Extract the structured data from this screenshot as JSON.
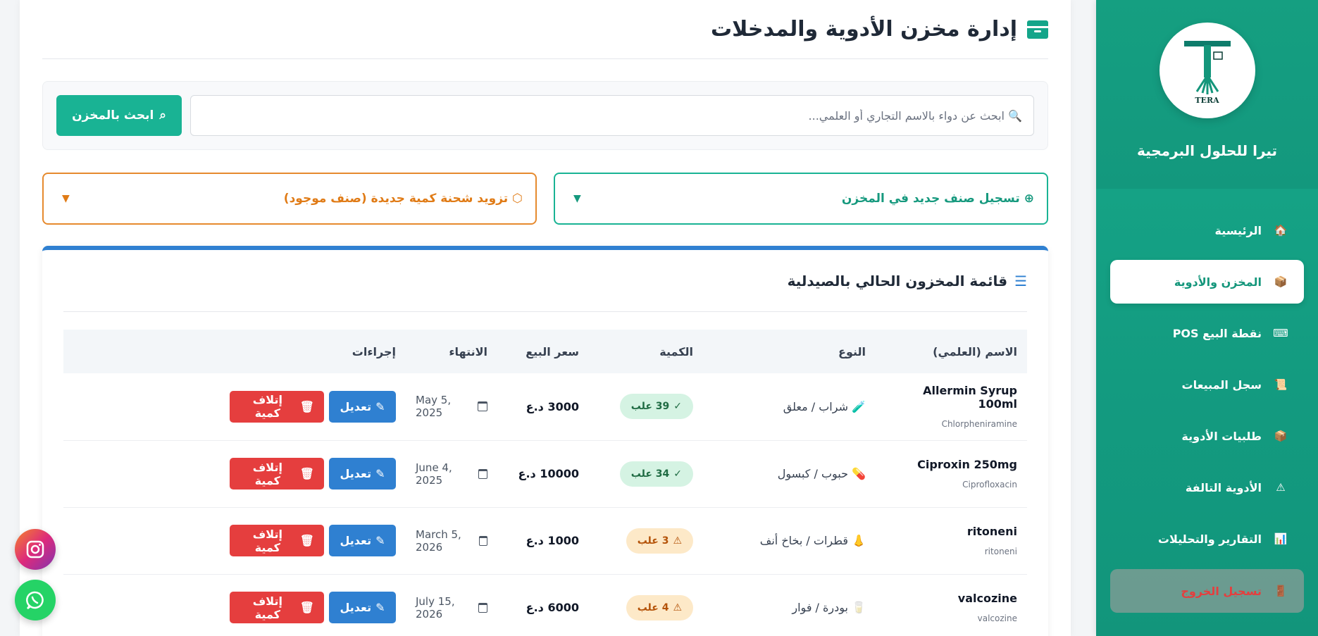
{
  "sidebar": {
    "brand": "تيرا للحلول البرمجية",
    "logo_text": "TERA",
    "items": [
      {
        "label": "الرئيسية",
        "icon": "house-icon",
        "glyph": "🏠",
        "active": false
      },
      {
        "label": "المخزن والأدوية",
        "icon": "box-icon",
        "glyph": "📦",
        "active": true
      },
      {
        "label": "نقطة البيع POS",
        "icon": "keyboard-icon",
        "glyph": "⌨",
        "active": false
      },
      {
        "label": "سجل المبيعات",
        "icon": "scroll-icon",
        "glyph": "📜",
        "active": false
      },
      {
        "label": "طلبيات الأدوية",
        "icon": "package-icon",
        "glyph": "📦",
        "active": false
      },
      {
        "label": "الأدوية التالفة",
        "icon": "warning-icon",
        "glyph": "⚠",
        "active": false
      },
      {
        "label": "التقارير والتحليلات",
        "icon": "chart-icon",
        "glyph": "📊",
        "active": false
      }
    ],
    "logout_label": "تسجيل الخروج",
    "logout_glyph": "🚪"
  },
  "header": {
    "title": "إدارة مخزن الأدوية والمدخلات"
  },
  "search": {
    "placeholder": "🔍 ابحث عن دواء بالاسم التجاري أو العلمي...",
    "button_label": "ابحث بالمخزن",
    "button_glyph": "⌕"
  },
  "accordions": {
    "new_item": {
      "label": "تسجيل صنف جديد في المخزن",
      "glyph": "⊕",
      "caret": "▼"
    },
    "restock": {
      "label": "تزويد شحنة كمية جديدة (صنف موجود)",
      "glyph": "⬡",
      "caret": "▼"
    }
  },
  "inventory": {
    "title": "قائمة المخزون الحالي بالصيدلية",
    "columns": {
      "name": "الاسم (العلمي)",
      "type": "النوع",
      "quantity": "الكمية",
      "price": "سعر البيع",
      "expiry": "الانتهاء",
      "actions": "إجراءات"
    },
    "edit_label": "تعديل",
    "destroy_label": "إتلاف كمية",
    "rows": [
      {
        "name": "Allermin Syrup 100ml",
        "scientific": "Chlorpheniramine",
        "type": "شراب / معلق",
        "type_glyph": "🧪",
        "quantity": "39 علب",
        "qty_status": "ok",
        "qty_glyph": "✓",
        "price": "3000 د.ع",
        "expiry": "May 5, 2025"
      },
      {
        "name": "Ciproxin 250mg",
        "scientific": "Ciprofloxacin",
        "type": "حبوب / كبسول",
        "type_glyph": "💊",
        "quantity": "34 علب",
        "qty_status": "ok",
        "qty_glyph": "✓",
        "price": "10000 د.ع",
        "expiry": "June 4, 2025"
      },
      {
        "name": "ritoneni",
        "scientific": "ritoneni",
        "type": "قطرات / بخاخ أنف",
        "type_glyph": "👃",
        "quantity": "3 علب",
        "qty_status": "warn",
        "qty_glyph": "⚠",
        "price": "1000 د.ع",
        "expiry": "March 5, 2026"
      },
      {
        "name": "valcozine",
        "scientific": "valcozine",
        "type": "بودرة / فوار",
        "type_glyph": "🥛",
        "quantity": "4 علب",
        "qty_status": "warn",
        "qty_glyph": "⚠",
        "price": "6000 د.ع",
        "expiry": "July 15, 2026"
      }
    ]
  }
}
